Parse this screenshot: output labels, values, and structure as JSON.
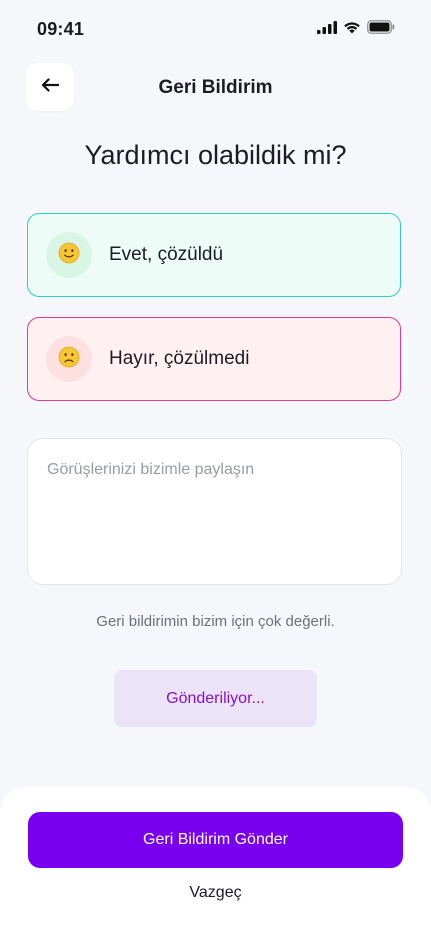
{
  "status_bar": {
    "time": "09:41",
    "icons": [
      "cellular-signal-icon",
      "wifi-icon",
      "battery-icon"
    ]
  },
  "header": {
    "title": "Geri Bildirim",
    "back_icon": "arrow-left-icon"
  },
  "question": "Yardımcı olabildik mi?",
  "options": [
    {
      "label": "Evet, çözüldü",
      "icon": "slightly-smiling-face-emoji",
      "accent": "#2fcfc8",
      "background": "#eefcf7"
    },
    {
      "label": "Hayır, çözülmedi",
      "icon": "slightly-frowning-face-emoji",
      "accent": "#e63a8d",
      "background": "#fff1f2"
    }
  ],
  "comment": {
    "placeholder": "Görüşlerinizi bizimle paylaşın",
    "value": ""
  },
  "helper_text": "Geri bildirimin bizim için çok değerli.",
  "loading_button": {
    "label": "Gönderiliyor..."
  },
  "footer": {
    "submit_label": "Geri Bildirim Gönder",
    "cancel_label": "Vazgeç"
  },
  "colors": {
    "primary": "#7a00f0",
    "loading_text": "#8a10c8",
    "loading_bg": "#ebe4f8"
  }
}
